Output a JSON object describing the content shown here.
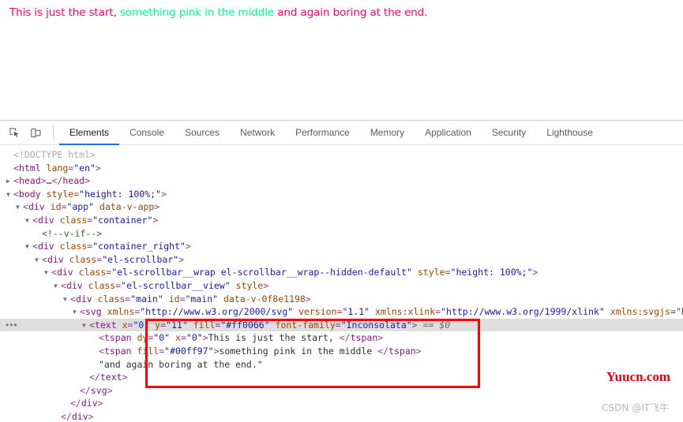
{
  "preview": {
    "segments": [
      {
        "text": "This is just the start, ",
        "color": "#ff0066"
      },
      {
        "text": "something pink in the middle ",
        "color": "#00ff97"
      },
      {
        "text": "and again boring at the end.",
        "color": "#ff0066"
      }
    ]
  },
  "devtools": {
    "icons": {
      "inspect": "inspect-element-icon",
      "device": "device-toolbar-icon"
    },
    "tabs": [
      {
        "label": "Elements",
        "active": true
      },
      {
        "label": "Console",
        "active": false
      },
      {
        "label": "Sources",
        "active": false
      },
      {
        "label": "Network",
        "active": false
      },
      {
        "label": "Performance",
        "active": false
      },
      {
        "label": "Memory",
        "active": false
      },
      {
        "label": "Application",
        "active": false
      },
      {
        "label": "Security",
        "active": false
      },
      {
        "label": "Lighthouse",
        "active": false
      }
    ],
    "overflow_label": "•••",
    "dom_rows": [
      {
        "indent": 0,
        "twisty": "none",
        "line": "<!DOCTYPE html>"
      },
      {
        "indent": 0,
        "twisty": "none",
        "line": "<html lang=\"en\">"
      },
      {
        "indent": 0,
        "twisty": "closed",
        "line": "<head>…</head>"
      },
      {
        "indent": 0,
        "twisty": "open",
        "line": "<body style=\"height: 100%;\">"
      },
      {
        "indent": 1,
        "twisty": "open",
        "line": "<div id=\"app\" data-v-app>"
      },
      {
        "indent": 2,
        "twisty": "open",
        "line": "<div class=\"container\">"
      },
      {
        "indent": 3,
        "twisty": "none",
        "line": "<!--v-if-->"
      },
      {
        "indent": 2,
        "twisty": "open",
        "line": "<div class=\"container_right\">"
      },
      {
        "indent": 3,
        "twisty": "open",
        "line": "<div class=\"el-scrollbar\">"
      },
      {
        "indent": 4,
        "twisty": "open",
        "line": "<div class=\"el-scrollbar__wrap el-scrollbar__wrap--hidden-default\" style=\"height: 100%;\">"
      },
      {
        "indent": 5,
        "twisty": "open",
        "line": "<div class=\"el-scrollbar__view\" style>"
      },
      {
        "indent": 6,
        "twisty": "open",
        "line": "<div class=\"main\" id=\"main\" data-v-0f8e1198>"
      },
      {
        "indent": 7,
        "twisty": "open",
        "line": "<svg xmlns=\"http://www.w3.org/2000/svg\" version=\"1.1\" xmlns:xlink=\"http://www.w3.org/1999/xlink\" xmlns:svgjs=\"ht"
      },
      {
        "indent": 8,
        "twisty": "open",
        "line": "<text x=\"0\" y=\"11\" fill=\"#ff0066\" font-family=\"Inconsolata\">",
        "suffix": " == $0",
        "selected": true
      },
      {
        "indent": 9,
        "twisty": "none",
        "line": "<tspan dy=\"0\" x=\"0\">This is just the start, </tspan>"
      },
      {
        "indent": 9,
        "twisty": "none",
        "line": "<tspan fill=\"#00ff97\">something pink in the middle </tspan>"
      },
      {
        "indent": 9,
        "twisty": "none",
        "line": "\"and again boring at the end.\""
      },
      {
        "indent": 8,
        "twisty": "none",
        "line": "</text>"
      },
      {
        "indent": 7,
        "twisty": "none",
        "line": "</svg>"
      },
      {
        "indent": 6,
        "twisty": "none",
        "line": "</div>"
      },
      {
        "indent": 5,
        "twisty": "none",
        "line": "</div>"
      }
    ]
  },
  "annotations": {
    "highlight_color": "#fb0007"
  },
  "watermarks": {
    "primary": "Yuucn.com",
    "secondary": "CSDN @IT飞牛"
  }
}
